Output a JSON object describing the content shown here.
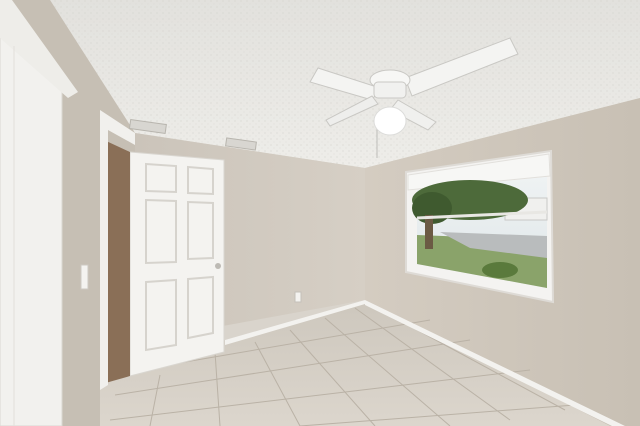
{
  "scene": {
    "subject": "empty bedroom",
    "elements": [
      "textured-ceiling",
      "ceiling-fan",
      "ceiling-light",
      "air-vent",
      "white-panel-door",
      "closet-door",
      "window-with-blinds",
      "tile-floor",
      "baseboard",
      "electrical-outlet",
      "light-switch"
    ]
  },
  "colors": {
    "ceiling": "#e9e8e4",
    "wall_left": "#ccc5bb",
    "wall_back": "#d2cbc1",
    "wall_right": "#cfc7bc",
    "floor": "#d6d0c6",
    "grout": "#bdb5aa",
    "door": "#f4f3f0",
    "trim": "#f2f1ee",
    "window_sky": "#e6ecee",
    "foliage": "#4d6a3a"
  }
}
